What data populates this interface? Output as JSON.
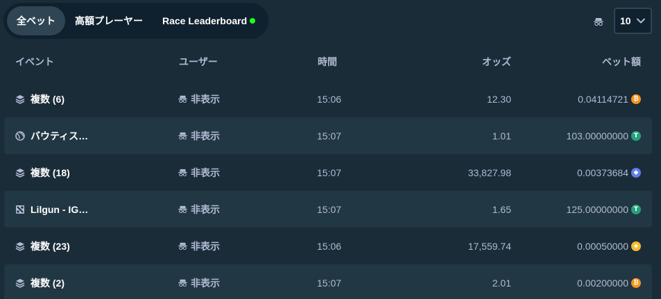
{
  "tabs": [
    {
      "label": "全ベット",
      "active": true
    },
    {
      "label": "高額プレーヤー",
      "active": false
    },
    {
      "label": "Race Leaderboard",
      "active": false,
      "live_dot_color": "#1fff20"
    }
  ],
  "page_size": {
    "value": "10",
    "icon": "chevron-down-icon"
  },
  "table": {
    "headers": {
      "event": "イベント",
      "user": "ユーザー",
      "time": "時間",
      "odds": "オッズ",
      "bet": "ベット額"
    },
    "rows": [
      {
        "event_icon": "stack-icon",
        "event": "複数 (6)",
        "user": "非表示",
        "time": "15:06",
        "odds": "12.30",
        "bet": "0.04114721",
        "currency_icon": "bitcoin-icon",
        "coin_color": "#f7931a",
        "coin_glyph": "₿"
      },
      {
        "event_icon": "sport-ball-icon",
        "event": "バウティス…",
        "user": "非表示",
        "time": "15:07",
        "odds": "1.01",
        "bet": "103.00000000",
        "currency_icon": "tether-icon",
        "coin_color": "#26a17b",
        "coin_glyph": "T"
      },
      {
        "event_icon": "stack-icon",
        "event": "複数 (18)",
        "user": "非表示",
        "time": "15:07",
        "odds": "33,827.98",
        "bet": "0.00373684",
        "currency_icon": "ethereum-icon",
        "coin_color": "#627eea",
        "coin_glyph": "◆"
      },
      {
        "event_icon": "dota-icon",
        "event": "Lilgun - IG…",
        "user": "非表示",
        "time": "15:07",
        "odds": "1.65",
        "bet": "125.00000000",
        "currency_icon": "tether-icon",
        "coin_color": "#26a17b",
        "coin_glyph": "T"
      },
      {
        "event_icon": "stack-icon",
        "event": "複数 (23)",
        "user": "非表示",
        "time": "15:06",
        "odds": "17,559.74",
        "bet": "0.00050000",
        "currency_icon": "bnb-icon",
        "coin_color": "#f3ba2f",
        "coin_glyph": "◈"
      },
      {
        "event_icon": "stack-icon",
        "event": "複数 (2)",
        "user": "非表示",
        "time": "15:07",
        "odds": "2.01",
        "bet": "0.00200000",
        "currency_icon": "bitcoin-icon",
        "coin_color": "#f7931a",
        "coin_glyph": "₿"
      }
    ]
  },
  "colors": {
    "background": "#1a2c38",
    "row_alt": "#213743",
    "tab_bar": "#0f212e",
    "tab_active": "#2f4553",
    "text_muted": "#b1bad3"
  }
}
